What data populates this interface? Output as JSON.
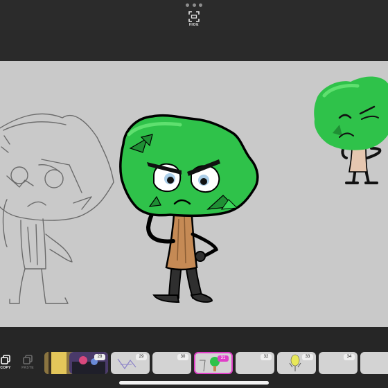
{
  "top_bar": {
    "more_icon": "ellipsis-icon",
    "hide_label": "HIDE",
    "hide_icon": "frame-corners-icon"
  },
  "tools": {
    "copy_label": "COPY",
    "paste_label": "PASTE"
  },
  "frames": [
    {
      "number": "27",
      "selected": false
    },
    {
      "number": "28",
      "selected": false
    },
    {
      "number": "29",
      "selected": false
    },
    {
      "number": "30",
      "selected": false
    },
    {
      "number": "31",
      "selected": true
    },
    {
      "number": "32",
      "selected": false
    },
    {
      "number": "33",
      "selected": false
    },
    {
      "number": "34",
      "selected": false
    }
  ],
  "colors": {
    "background": "#2a2a2a",
    "canvas": "#c9c9c9",
    "selection_accent": "#e040c8",
    "tree_green": "#2fc24a"
  }
}
